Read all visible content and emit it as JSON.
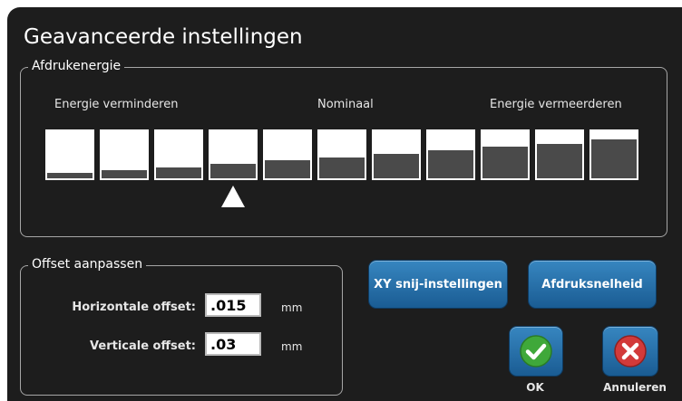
{
  "dialog": {
    "title": "Geavanceerde instellingen"
  },
  "energy": {
    "legend": "Afdrukenergie",
    "label_less": "Energie verminderen",
    "label_nominal": "Nominaal",
    "label_more": "Energie vermeerderen",
    "levels": [
      0.12,
      0.18,
      0.24,
      0.3,
      0.38,
      0.44,
      0.52,
      0.6,
      0.68,
      0.74,
      0.82
    ],
    "selected_index": 3
  },
  "offset": {
    "legend": "Offset aanpassen",
    "horizontal_label": "Horizontale offset:",
    "horizontal_value": ".015",
    "vertical_label": "Verticale offset:",
    "vertical_value": ".03",
    "unit": "mm"
  },
  "buttons": {
    "xy_cut": "XY snij-instellingen",
    "print_speed": "Afdruksnelheid",
    "ok": "OK",
    "cancel": "Annuleren"
  },
  "colors": {
    "background": "#1d1d1d",
    "button_blue": "#2a73ad",
    "ok_green": "#3fa83a",
    "cancel_red": "#d23a3a"
  },
  "icons": {
    "ok": "check-icon",
    "cancel": "close-icon",
    "pointer": "triangle-up-icon"
  }
}
